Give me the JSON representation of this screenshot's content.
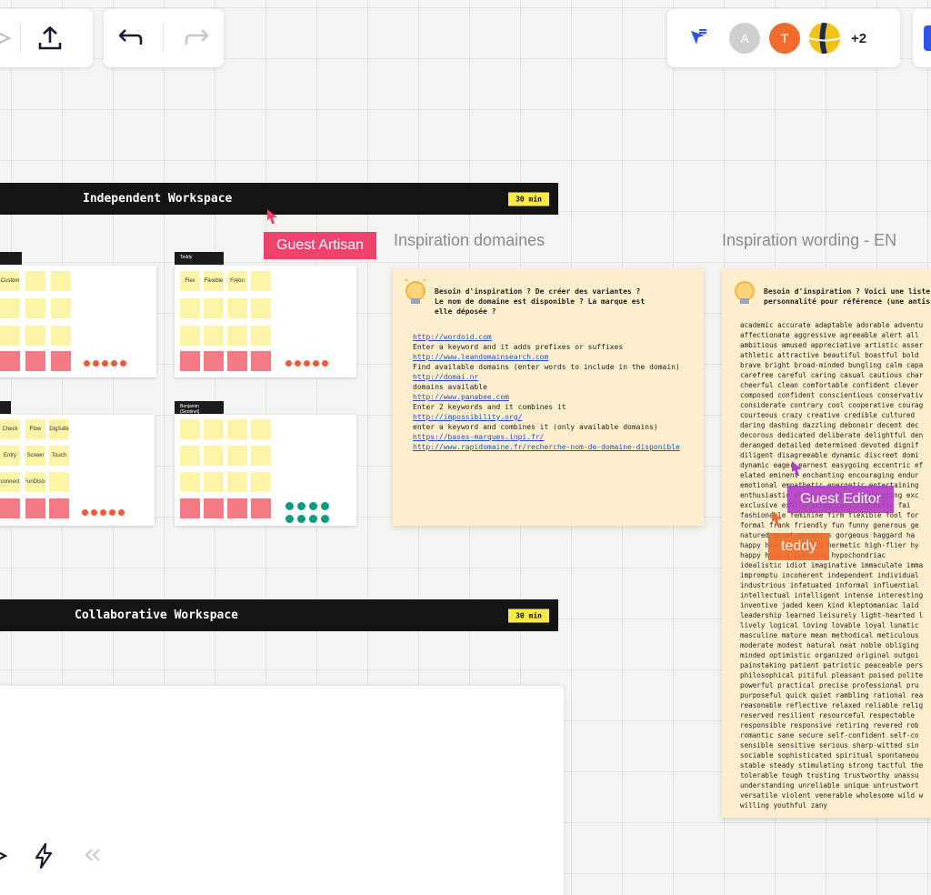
{
  "toolbar_right": {
    "avatars": [
      {
        "letter": "A",
        "color": "#cfcfcf"
      },
      {
        "letter": "T",
        "color": "#f26b2c"
      },
      {
        "letter": "",
        "color": "#f2c21b"
      }
    ],
    "more_count": "+2"
  },
  "frames": {
    "independent": {
      "title": "Independent Workspace",
      "timer": "30 min"
    },
    "collaborative": {
      "title": "Collaborative Workspace",
      "timer": "30 min"
    }
  },
  "cursors": {
    "guest_artisan": {
      "label": "Guest Artisan",
      "color": "#f0426c"
    },
    "guest_editor": {
      "label": "Guest Editor",
      "color": "#b23fc4"
    },
    "teddy": {
      "label": "teddy",
      "color": "#f26b2c"
    }
  },
  "boards": [
    {
      "tag": "",
      "stickies": [
        "Custom",
        "",
        ""
      ]
    },
    {
      "tag": "Teddy",
      "stickies": [
        "Flex",
        "Flexible",
        "Freon"
      ]
    },
    {
      "tag": "",
      "stickies": [
        "Check",
        "Flow",
        "DigSafe",
        "Entry",
        "Screen",
        "Touch",
        "connect",
        "FunDisco",
        ""
      ]
    },
    {
      "tag": "Benjamin (Sentinel)",
      "stickies": []
    }
  ],
  "sections": {
    "domaines_title": "Inspiration domaines",
    "wording_title": "Inspiration wording - EN"
  },
  "domaines_card": {
    "heading": [
      "Besoin d'inspiration ? De créer des variantes ?",
      "Le nom de domaine est disponible ? La marque est",
      "elle déposée ?"
    ],
    "lines": [
      {
        "kind": "link",
        "text": "http://wordoid.com"
      },
      {
        "kind": "txt",
        "text": "Enter a keyword and it adds prefixes or suffixes"
      },
      {
        "kind": "gap",
        "text": ""
      },
      {
        "kind": "link",
        "text": "http://www.leandomainsearch.com"
      },
      {
        "kind": "txt",
        "text": "Find available domains (enter words to include in the domain)"
      },
      {
        "kind": "gap",
        "text": ""
      },
      {
        "kind": "link",
        "text": "http://domai.nr"
      },
      {
        "kind": "txt",
        "text": "domains available"
      },
      {
        "kind": "link",
        "text": "http://www.panabee.com"
      },
      {
        "kind": "txt",
        "text": "Enter 2 keywords and it combines it"
      },
      {
        "kind": "gap",
        "text": ""
      },
      {
        "kind": "link",
        "text": "http://impossibility.org/"
      },
      {
        "kind": "txt",
        "text": "enter a keyword and combines it (only available domains)"
      },
      {
        "kind": "gap",
        "text": ""
      },
      {
        "kind": "link",
        "text": "https://bases-marques.inpi.fr/"
      },
      {
        "kind": "gap",
        "text": ""
      },
      {
        "kind": "link",
        "text": "http://www.rapidomaine.fr/recherche-nom-de-domaine-disponible"
      }
    ]
  },
  "wording_card": {
    "heading": [
      "Besoin d'inspiration ? Voici une liste",
      "personnalité pour référence (une antis"
    ],
    "lines": [
      "academic accurate adaptable adorable adventu",
      "affectionate aggressive agreeable alert all",
      "ambitious amused appreciative artistic asser",
      "athletic attractive beautiful boastful bold",
      "brave bright broad-minded bungling calm capa",
      "carefree careful caring casual cautious char",
      "cheerful clean comfortable confident clever",
      "composed confident conscientious conservativ",
      "considerate contrary cool cooperative courag",
      "courteous crazy creative credible cultured",
      "daring dashing dazzling debonair decent dec",
      "decorous dedicated deliberate delightful den",
      "deranged detailed determined devoted dignif",
      "diligent disagreeable dynamic discreet domi",
      "dynamic eager earnest easygoing eccentric ef",
      "elated eminent enchanting encouraging endur",
      "emotional empathetic energetic entertaining",
      "enthusiastic ethical excellent exciting exc",
      "exclusive exhilarating fair fantastic fai",
      "fashionable feminine firm flexible fool for",
      "formal frank friendly fun funny generous ge",
      "natured great gorgeous gorgeous haggard ha",
      "happy hearty helpful hermetic high-flier hy",
      "happy honest humorous hypochondriac",
      "idealistic idiot imaginative immaculate imma",
      "impromptu incoherent independent individual",
      "industrious infatuated informal influential",
      "intellectual intelligent intense interesting",
      "inventive jaded keen kind kleptomaniac laid",
      "leadership learned leisurely light-hearted l",
      "lively logical loving lovable loyal lunatic",
      "masculine mature mean methodical meticulous",
      "moderate modest natural neat noble obliging",
      "minded optimistic organized original outgoi",
      "painstaking patient patriotic peaceable pers",
      "philosophical pitiful pleasant poised polite",
      "powerful practical precise professional pru",
      "purposeful quick quiet rambling rational rea",
      "reasonable reflective relaxed reliable relig",
      "reserved resilient resourceful respectable",
      "responsible responsive retiring revered rob",
      "romantic sane secure self-confident self-co",
      "sensible sensitive serious sharp-witted sin",
      "sociable sophisticated spiritual spontaneou",
      "stable steady stimulating strong tactful the",
      "tolerable tough trusting trustworthy unassu",
      "understanding unreliable unique untrustwort",
      "versatile violent venerable wholesome wild w",
      "willing youthful zany"
    ]
  }
}
